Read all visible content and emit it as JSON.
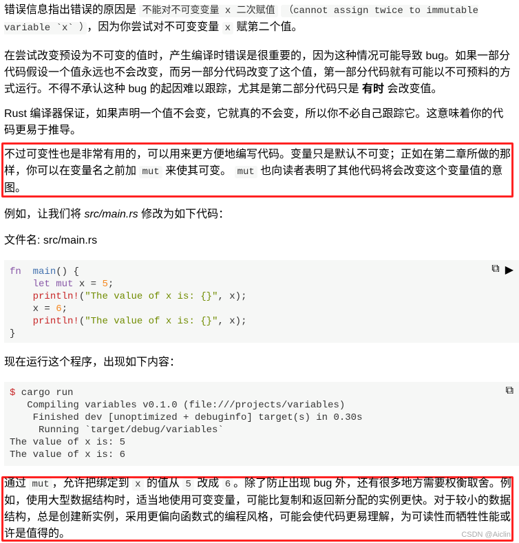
{
  "paragraphs": [
    {
      "id": "p1",
      "segments": [
        {
          "t": "text",
          "v": "错误信息指出错误的原因是 "
        },
        {
          "t": "code",
          "v": "不能对不可变变量 x 二次赋值"
        },
        {
          "t": "text",
          "v": " "
        },
        {
          "t": "code",
          "v": "（cannot assign twice to immutable variable `x` ）"
        },
        {
          "t": "text",
          "v": "，因为你尝试对不可变变量 "
        },
        {
          "t": "code",
          "v": "x"
        },
        {
          "t": "text",
          "v": " 赋第二个值。"
        }
      ]
    },
    {
      "id": "p2",
      "segments": [
        {
          "t": "text",
          "v": "在尝试改变预设为不可变的值时，产生编译时错误是很重要的，因为这种情况可能导致 bug。如果一部分代码假设一个值永远也不会改变，而另一部分代码改变了这个值，第一部分代码就有可能以不可预料的方式运行。不得不承认这种 bug 的起因难以跟踪，尤其是第二部分代码只是 "
        },
        {
          "t": "bold",
          "v": "有时"
        },
        {
          "t": "text",
          "v": " 会改变值。"
        }
      ]
    },
    {
      "id": "p3",
      "segments": [
        {
          "t": "text",
          "v": "Rust 编译器保证，如果声明一个值不会变，它就真的不会变，所以你不必自己跟踪它。这意味着你的代码更易于推导。"
        }
      ]
    },
    {
      "id": "p4",
      "segments": [
        {
          "t": "text",
          "v": "不过可变性也是非常有用的，可以用来更方便地编写代码。变量只是默认不可变；正如在第二章所做的那样，你可以在变量名之前加 "
        },
        {
          "t": "code",
          "v": "mut"
        },
        {
          "t": "text",
          "v": " 来使其可变。 "
        },
        {
          "t": "code",
          "v": "mut"
        },
        {
          "t": "text",
          "v": " 也向读者表明了其他代码将会改变这个变量值的意图。"
        }
      ]
    },
    {
      "id": "p5",
      "segments": [
        {
          "t": "text",
          "v": "例如，让我们将 "
        },
        {
          "t": "em",
          "v": "src/main.rs"
        },
        {
          "t": "text",
          "v": " 修改为如下代码："
        }
      ]
    },
    {
      "id": "p6",
      "segments": [
        {
          "t": "text",
          "v": "文件名: src/main.rs"
        }
      ]
    },
    {
      "id": "p7",
      "segments": [
        {
          "t": "text",
          "v": "现在运行这个程序，出现如下内容："
        }
      ]
    },
    {
      "id": "p8",
      "segments": [
        {
          "t": "text",
          "v": "通过 "
        },
        {
          "t": "code",
          "v": "mut"
        },
        {
          "t": "text",
          "v": "，允许把绑定到 "
        },
        {
          "t": "code",
          "v": "x"
        },
        {
          "t": "text",
          "v": " 的值从 "
        },
        {
          "t": "code",
          "v": "5"
        },
        {
          "t": "text",
          "v": " 改成 "
        },
        {
          "t": "code",
          "v": "6"
        },
        {
          "t": "text",
          "v": "。除了防止出现 bug 外，还有很多地方需要权衡取舍。例如，使用大型数据结构时，适当地使用可变变量，可能比复制和返回新分配的实例更快。对于较小的数据结构，总是创建新实例，采用更偏向函数式的编程风格，可能会使代码更易理解，为可读性而牺牲性能或许是值得的。"
        }
      ]
    }
  ],
  "code_block": {
    "lines": [
      [
        [
          "kw",
          "fn"
        ],
        [
          "",
          "  "
        ],
        [
          "fnn",
          "main"
        ],
        [
          "",
          "() {"
        ]
      ],
      [
        [
          "",
          "    "
        ],
        [
          "kw",
          "let"
        ],
        [
          "",
          " "
        ],
        [
          "kw",
          "mut"
        ],
        [
          "",
          " x = "
        ],
        [
          "num",
          "5"
        ],
        [
          "",
          ";"
        ]
      ],
      [
        [
          "",
          "    "
        ],
        [
          "mac",
          "println!"
        ],
        [
          "",
          "("
        ],
        [
          "str",
          "\"The value of x is: {}\""
        ],
        [
          "",
          ", x);"
        ]
      ],
      [
        [
          "",
          "    x = "
        ],
        [
          "num",
          "6"
        ],
        [
          "",
          ";"
        ]
      ],
      [
        [
          "",
          "    "
        ],
        [
          "mac",
          "println!"
        ],
        [
          "",
          "("
        ],
        [
          "str",
          "\"The value of x is: {}\""
        ],
        [
          "",
          ", x);"
        ]
      ],
      [
        [
          "",
          "}"
        ]
      ]
    ],
    "copy_icon": "copy-icon",
    "run_icon": "play-icon"
  },
  "output_block": {
    "lines": [
      [
        [
          "prompt",
          "$"
        ],
        [
          "",
          " cargo run"
        ]
      ],
      [
        [
          "",
          "   Compiling variables v0.1.0 (file:///projects/variables)"
        ]
      ],
      [
        [
          "",
          "    Finished dev [unoptimized + debuginfo] target(s) in 0.30s"
        ]
      ],
      [
        [
          "",
          "     Running `target/debug/variables`"
        ]
      ],
      [
        [
          "",
          "The value of x is: 5"
        ]
      ],
      [
        [
          "",
          "The value of x is: 6"
        ]
      ]
    ],
    "copy_icon": "copy-icon"
  },
  "watermark": "CSDN @Aiclin",
  "colors": {
    "highlight_border": "#ff2222",
    "code_bg": "#f6f7f6"
  }
}
